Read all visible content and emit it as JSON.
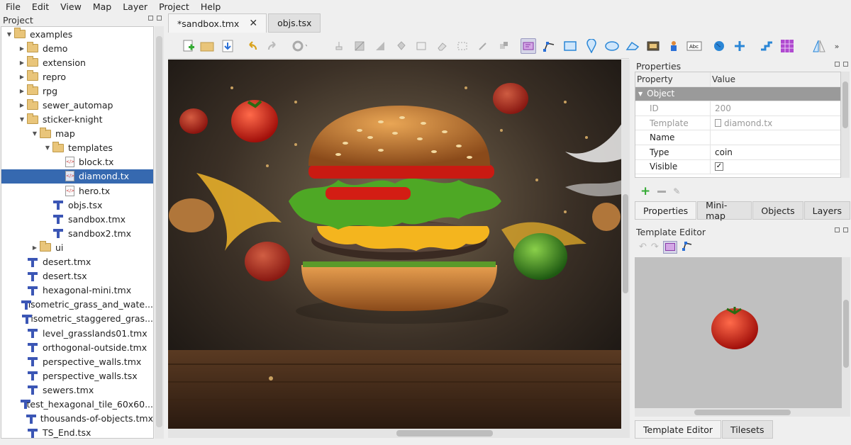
{
  "menu": [
    "File",
    "Edit",
    "View",
    "Map",
    "Layer",
    "Project",
    "Help"
  ],
  "project": {
    "title": "Project",
    "tree": [
      {
        "indent": 0,
        "arrow": "▼",
        "icon": "folder",
        "label": "examples"
      },
      {
        "indent": 1,
        "arrow": "▶",
        "icon": "folder",
        "label": "demo"
      },
      {
        "indent": 1,
        "arrow": "▶",
        "icon": "folder",
        "label": "extension"
      },
      {
        "indent": 1,
        "arrow": "▶",
        "icon": "folder",
        "label": "repro"
      },
      {
        "indent": 1,
        "arrow": "▶",
        "icon": "folder",
        "label": "rpg"
      },
      {
        "indent": 1,
        "arrow": "▶",
        "icon": "folder",
        "label": "sewer_automap"
      },
      {
        "indent": 1,
        "arrow": "▼",
        "icon": "folder",
        "label": "sticker-knight"
      },
      {
        "indent": 2,
        "arrow": "▼",
        "icon": "folder",
        "label": "map"
      },
      {
        "indent": 3,
        "arrow": "▼",
        "icon": "folder",
        "label": "templates"
      },
      {
        "indent": 4,
        "arrow": "",
        "icon": "tx",
        "label": "block.tx"
      },
      {
        "indent": 4,
        "arrow": "",
        "icon": "tx",
        "label": "diamond.tx",
        "selected": true
      },
      {
        "indent": 4,
        "arrow": "",
        "icon": "tx",
        "label": "hero.tx"
      },
      {
        "indent": 3,
        "arrow": "",
        "icon": "tiled",
        "label": "objs.tsx"
      },
      {
        "indent": 3,
        "arrow": "",
        "icon": "tiled",
        "label": "sandbox.tmx"
      },
      {
        "indent": 3,
        "arrow": "",
        "icon": "tiled",
        "label": "sandbox2.tmx"
      },
      {
        "indent": 2,
        "arrow": "▶",
        "icon": "folder",
        "label": "ui"
      },
      {
        "indent": 1,
        "arrow": "",
        "icon": "tiled",
        "label": "desert.tmx"
      },
      {
        "indent": 1,
        "arrow": "",
        "icon": "tiled",
        "label": "desert.tsx"
      },
      {
        "indent": 1,
        "arrow": "",
        "icon": "tiled",
        "label": "hexagonal-mini.tmx"
      },
      {
        "indent": 1,
        "arrow": "",
        "icon": "tiled",
        "label": "isometric_grass_and_wate..."
      },
      {
        "indent": 1,
        "arrow": "",
        "icon": "tiled",
        "label": "isometric_staggered_gras..."
      },
      {
        "indent": 1,
        "arrow": "",
        "icon": "tiled",
        "label": "level_grasslands01.tmx"
      },
      {
        "indent": 1,
        "arrow": "",
        "icon": "tiled",
        "label": "orthogonal-outside.tmx"
      },
      {
        "indent": 1,
        "arrow": "",
        "icon": "tiled",
        "label": "perspective_walls.tmx"
      },
      {
        "indent": 1,
        "arrow": "",
        "icon": "tiled",
        "label": "perspective_walls.tsx"
      },
      {
        "indent": 1,
        "arrow": "",
        "icon": "tiled",
        "label": "sewers.tmx"
      },
      {
        "indent": 1,
        "arrow": "",
        "icon": "tiled",
        "label": "test_hexagonal_tile_60x60..."
      },
      {
        "indent": 1,
        "arrow": "",
        "icon": "tiled",
        "label": "thousands-of-objects.tmx"
      },
      {
        "indent": 1,
        "arrow": "",
        "icon": "tiled",
        "label": "TS_End.tsx"
      }
    ]
  },
  "tabs": [
    {
      "label": "*sandbox.tmx",
      "active": true
    },
    {
      "label": "objs.tsx",
      "active": false
    }
  ],
  "properties": {
    "title": "Properties",
    "col_property": "Property",
    "col_value": "Value",
    "group": "Object",
    "rows": [
      {
        "key": "ID",
        "value": "200",
        "dim": true
      },
      {
        "key": "Template",
        "value": "diamond.tx",
        "dim": true
      },
      {
        "key": "Name",
        "value": "",
        "dim": false
      },
      {
        "key": "Type",
        "value": "coin",
        "dim": false
      },
      {
        "key": "Visible",
        "value": "✓",
        "dim": false,
        "checkbox": true
      }
    ],
    "tabs": [
      "Properties",
      "Mini-map",
      "Objects",
      "Layers"
    ]
  },
  "template_editor": {
    "title": "Template Editor",
    "bottom_tabs": [
      "Template Editor",
      "Tilesets"
    ]
  }
}
